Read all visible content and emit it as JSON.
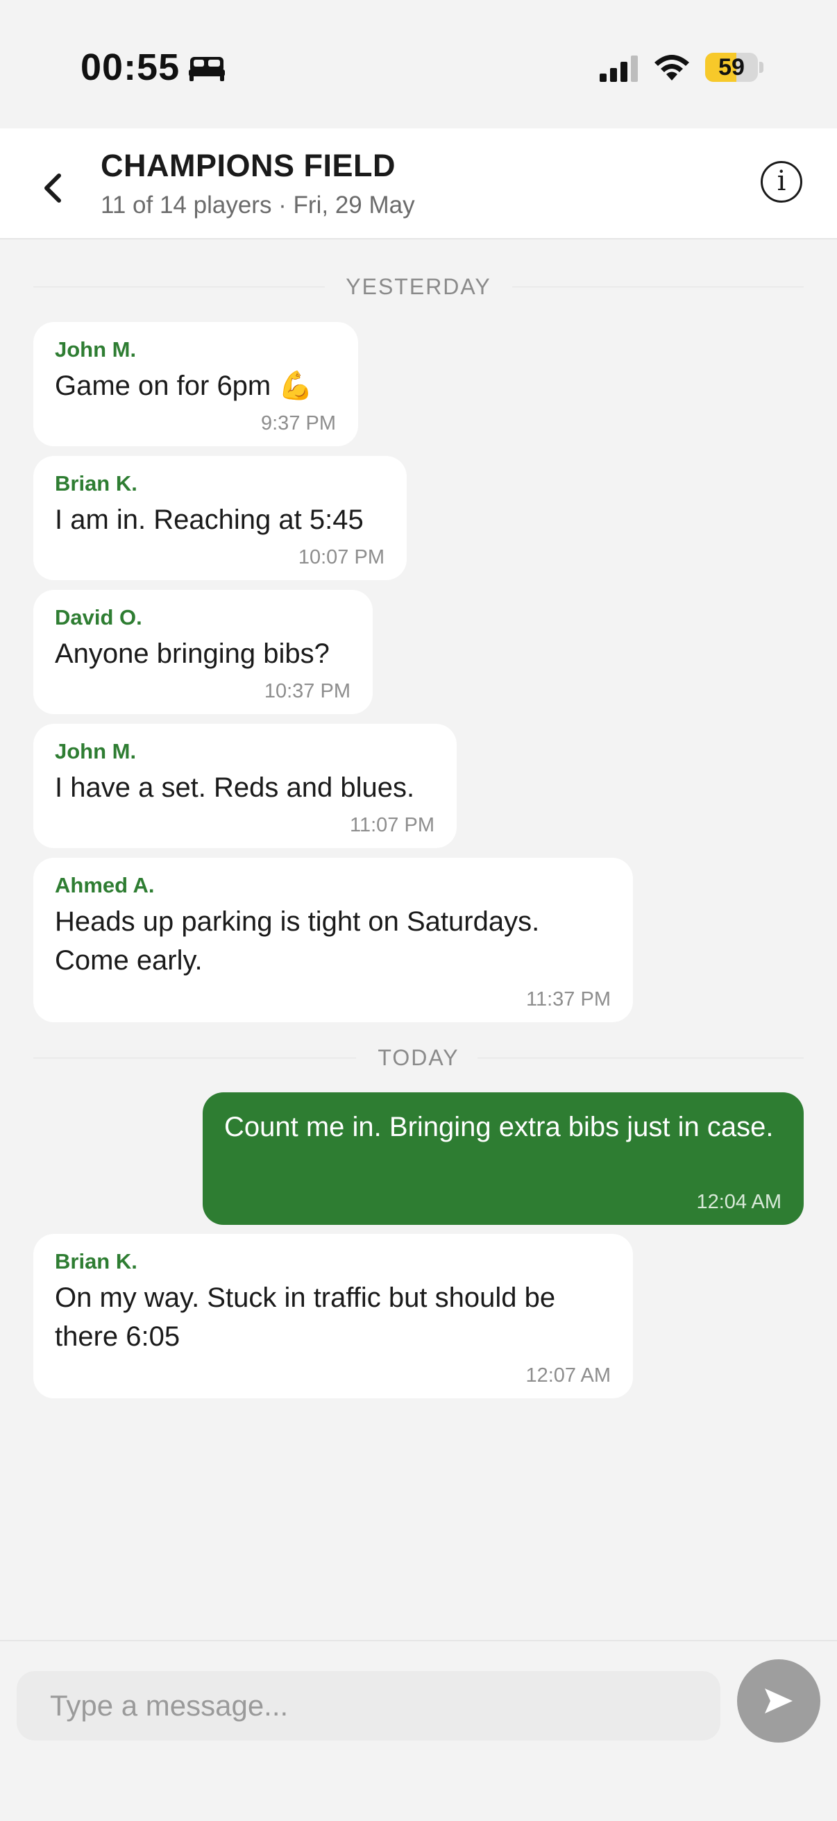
{
  "status_bar": {
    "time": "00:55",
    "battery_level": 59,
    "battery_text": "59",
    "battery_color": "#f7c92a",
    "icons": [
      "sleep-focus-icon",
      "cellular-signal-icon",
      "wifi-icon",
      "battery-icon"
    ]
  },
  "header": {
    "back_icon": "chevron-left-icon",
    "title": "CHAMPIONS FIELD",
    "subtitle": "11 of 14 players · Fri, 29 May",
    "info_icon": "info-icon",
    "info_glyph": "i"
  },
  "dividers": {
    "yesterday": "YESTERDAY",
    "today": "TODAY"
  },
  "messages": [
    {
      "sender": "John M.",
      "text": "Game on for 6pm 💪",
      "time": "9:37 PM",
      "mine": false
    },
    {
      "sender": "Brian K.",
      "text": "I am in. Reaching at 5:45",
      "time": "10:07 PM",
      "mine": false
    },
    {
      "sender": "David O.",
      "text": "Anyone bringing bibs?",
      "time": "10:37 PM",
      "mine": false
    },
    {
      "sender": "John M.",
      "text": "I have a set. Reds and blues.",
      "time": "11:07 PM",
      "mine": false
    },
    {
      "sender": "Ahmed A.",
      "text": "Heads up parking is tight on Saturdays. Come early.",
      "time": "11:37 PM",
      "mine": false
    },
    {
      "sender": "",
      "text": "Count me in. Bringing extra bibs just in case.",
      "time": "12:04 AM",
      "mine": true
    },
    {
      "sender": "Brian K.",
      "text": "On my way. Stuck in traffic but should be there 6:05",
      "time": "12:07 AM",
      "mine": false
    }
  ],
  "composer": {
    "placeholder": "Type a message...",
    "value": "",
    "send_icon": "send-arrow-icon"
  },
  "colors": {
    "accent": "#2e7d32",
    "background": "#f3f3f3",
    "bubble": "#ffffff",
    "send_button_disabled": "#9e9e9e"
  }
}
